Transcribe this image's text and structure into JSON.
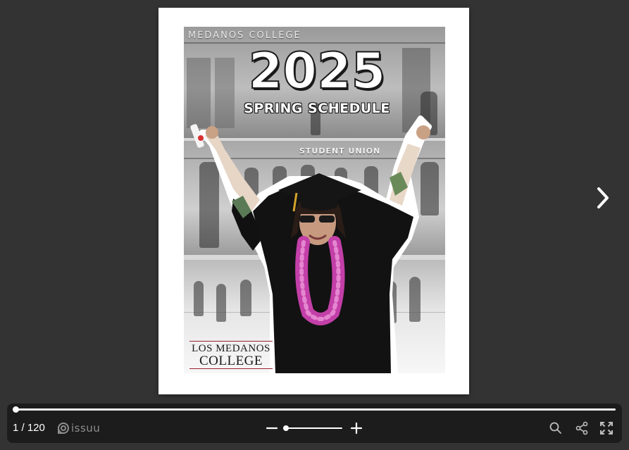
{
  "cover": {
    "year": "2025",
    "subtitle": "SPRING SCHEDULE",
    "sign_college": "MEDANOS COLLEGE",
    "sign_union": "STUDENT UNION",
    "logo_line1": "LOS MEDANOS",
    "logo_line2": "COLLEGE"
  },
  "viewer": {
    "page_counter": "1 / 120",
    "brand": "issuu",
    "progress_fraction": 0.0,
    "zoom_fraction": 0.0,
    "icons": {
      "next": "chevron-right-icon",
      "zoom_out": "minus-icon",
      "zoom_in": "plus-icon",
      "search": "search-icon",
      "share": "share-icon",
      "fullscreen": "fullscreen-icon",
      "brand": "issuu-logo-icon"
    }
  },
  "colors": {
    "background": "#333333",
    "toolbar": "#1c1c1c",
    "logo_accent": "#9c2233",
    "lei": "#c33fa8"
  }
}
